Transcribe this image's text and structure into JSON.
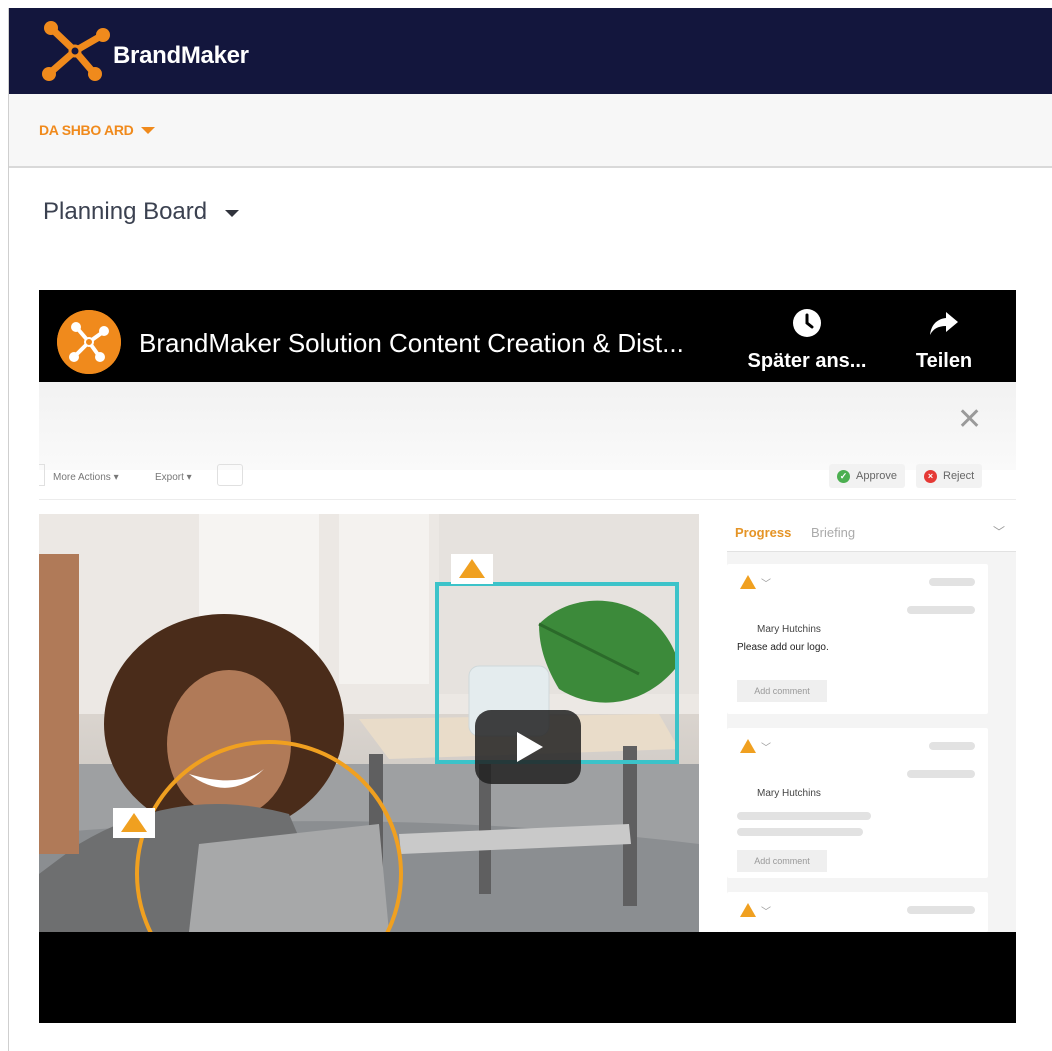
{
  "header": {
    "brand_name": "BrandMaker",
    "logo_color": "#f08a1c",
    "background": "#13163d",
    "logo_icon": "x-network-logo-icon"
  },
  "subnav": {
    "dashboard_label": "DA SHBO ARD",
    "accent": "#f08a1c"
  },
  "board": {
    "title": "Planning Board"
  },
  "video": {
    "title": "BrandMaker Solution Content Creation & Dist...",
    "watch_later_label": "Später ans...",
    "share_label": "Teilen",
    "watch_later_icon": "clock-icon",
    "share_icon": "share-arrow-icon",
    "play_icon": "play-icon"
  },
  "scene": {
    "toolbar": {
      "more_actions": "More Actions ▾",
      "export": "Export ▾",
      "approve": "Approve",
      "reject": "Reject"
    },
    "panel": {
      "tab_progress": "Progress",
      "tab_briefing": "Briefing",
      "cards": [
        {
          "commenter": "Mary Hutchins",
          "comment": "Please add our logo.",
          "add_comment": "Add comment"
        },
        {
          "commenter": "Mary Hutchins",
          "comment": "",
          "add_comment": "Add comment"
        }
      ]
    },
    "colors": {
      "progress": "#e59426",
      "highlight_box": "#3cc3c9",
      "highlight_circle": "#f0a020",
      "approve": "#4caf50",
      "reject": "#e53935"
    }
  }
}
